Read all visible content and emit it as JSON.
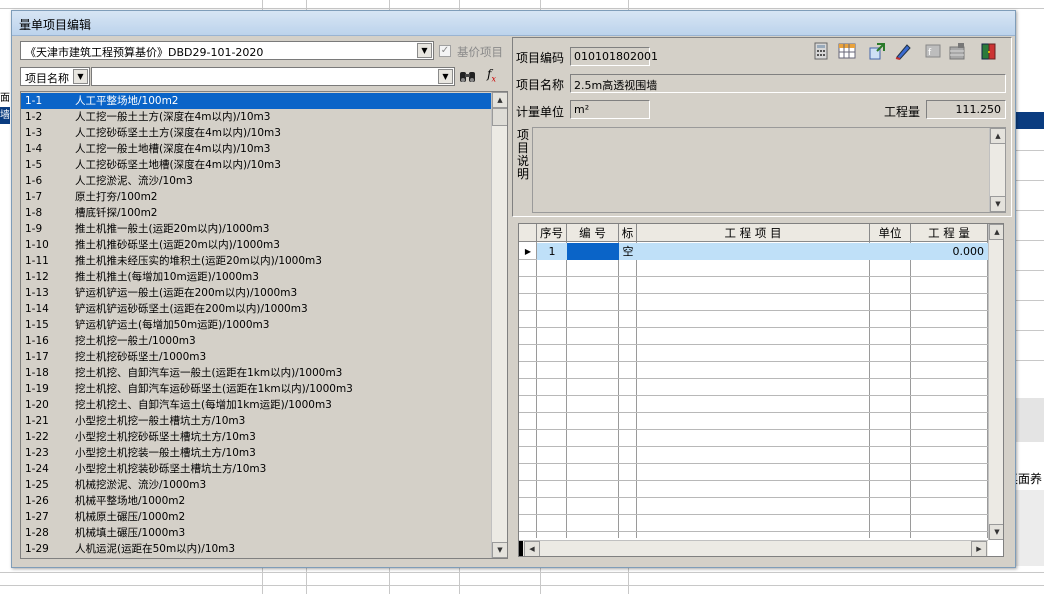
{
  "dialog": {
    "title": "量单项目编辑"
  },
  "left": {
    "library_value": "《天津市建筑工程预算基价》DBD29-101-2020",
    "base_price_label": "基价项目",
    "base_price_checked": true,
    "field_select_value": "项目名称",
    "search_value": "",
    "search_icon": "binoculars-icon",
    "formula_icon": "fx-icon",
    "items": [
      {
        "code": "1-1",
        "name": "人工平整场地/100m2"
      },
      {
        "code": "1-2",
        "name": "人工挖一般土土方(深度在4m以内)/10m3"
      },
      {
        "code": "1-3",
        "name": "人工挖砂砾坚土土方(深度在4m以内)/10m3"
      },
      {
        "code": "1-4",
        "name": "人工挖一般土地槽(深度在4m以内)/10m3"
      },
      {
        "code": "1-5",
        "name": "人工挖砂砾坚土地槽(深度在4m以内)/10m3"
      },
      {
        "code": "1-6",
        "name": "人工挖淤泥、流沙/10m3"
      },
      {
        "code": "1-7",
        "name": "原土打夯/100m2"
      },
      {
        "code": "1-8",
        "name": "槽底钎探/100m2"
      },
      {
        "code": "1-9",
        "name": "推土机推一般土(运距20m以内)/1000m3"
      },
      {
        "code": "1-10",
        "name": "推土机推砂砾坚土(运距20m以内)/1000m3"
      },
      {
        "code": "1-11",
        "name": "推土机推未经压实的堆积土(运距20m以内)/1000m3"
      },
      {
        "code": "1-12",
        "name": "推土机推土(每增加10m运距)/1000m3"
      },
      {
        "code": "1-13",
        "name": "铲运机铲运一般土(运距在200m以内)/1000m3"
      },
      {
        "code": "1-14",
        "name": "铲运机铲运砂砾坚土(运距在200m以内)/1000m3"
      },
      {
        "code": "1-15",
        "name": "铲运机铲运土(每增加50m运距)/1000m3"
      },
      {
        "code": "1-16",
        "name": "挖土机挖一般土/1000m3"
      },
      {
        "code": "1-17",
        "name": "挖土机挖砂砾坚土/1000m3"
      },
      {
        "code": "1-18",
        "name": "挖土机挖、自卸汽车运一般土(运距在1km以内)/1000m3"
      },
      {
        "code": "1-19",
        "name": "挖土机挖、自卸汽车运砂砾坚土(运距在1km以内)/1000m3"
      },
      {
        "code": "1-20",
        "name": "挖土机挖土、自卸汽车运土(每增加1km运距)/1000m3"
      },
      {
        "code": "1-21",
        "name": "小型挖土机挖一般土槽坑土方/10m3"
      },
      {
        "code": "1-22",
        "name": "小型挖土机挖砂砾坚土槽坑土方/10m3"
      },
      {
        "code": "1-23",
        "name": "小型挖土机挖装一般土槽坑土方/10m3"
      },
      {
        "code": "1-24",
        "name": "小型挖土机挖装砂砾坚土槽坑土方/10m3"
      },
      {
        "code": "1-25",
        "name": "机械挖淤泥、流沙/1000m3"
      },
      {
        "code": "1-26",
        "name": "机械平整场地/1000m2"
      },
      {
        "code": "1-27",
        "name": "机械原土碾压/1000m2"
      },
      {
        "code": "1-28",
        "name": "机械填土碾压/1000m3"
      },
      {
        "code": "1-29",
        "name": "人机运泥(运距在50m以内)/10m3"
      }
    ]
  },
  "right": {
    "code_label": "项目编码",
    "code_value": "010101802001",
    "name_label": "项目名称",
    "name_value": "2.5m高透视围墙",
    "unit_label": "计量单位",
    "unit_value": "m²",
    "qty_label": "工程量",
    "qty_value": "111.250",
    "desc_label": "项目说明",
    "desc_value": "",
    "toolbar_icons": [
      "calculator-icon",
      "table-icon",
      "import-icon",
      "edit-icon",
      "formula-icon",
      "grid-tool-icon",
      "exit-icon"
    ],
    "grid": {
      "headers": [
        "序号",
        "编 号",
        "标",
        "工  程  项  目",
        "单位",
        "工 程 量"
      ],
      "rows": [
        {
          "seq": "1",
          "code": "",
          "flag": "空",
          "item": "",
          "unit": "",
          "qty": "0.000"
        }
      ]
    }
  },
  "background": {
    "left_labels": [
      "面",
      "墙"
    ],
    "right_text": "桌面养"
  }
}
